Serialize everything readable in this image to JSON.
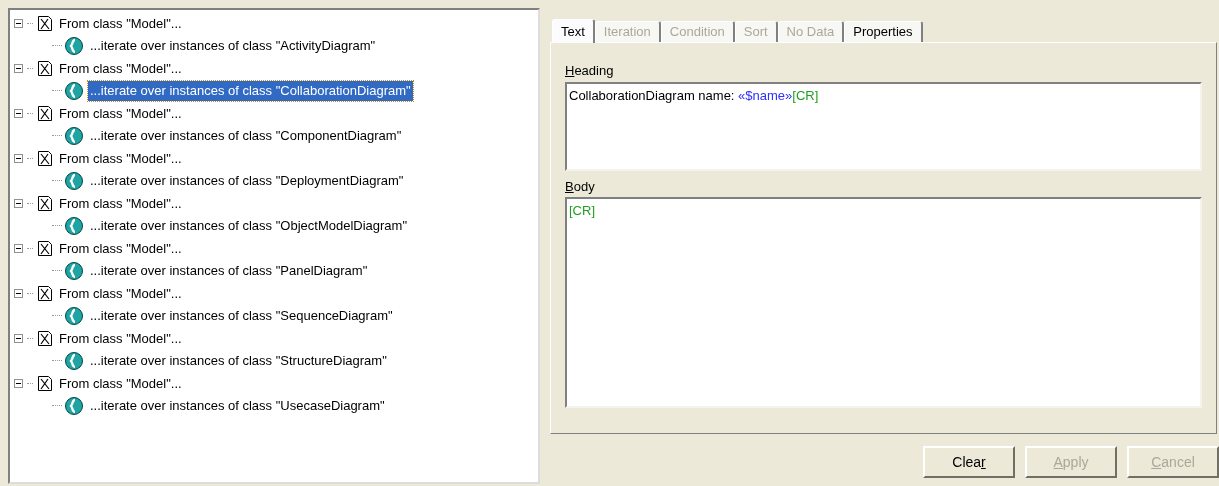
{
  "tree": [
    {
      "label": "From class \"Model\"...",
      "expanded": true,
      "children": [
        {
          "label": "...iterate over instances of class \"ActivityDiagram\"",
          "selected": false
        }
      ]
    },
    {
      "label": "From class \"Model\"...",
      "expanded": true,
      "children": [
        {
          "label": "...iterate over instances of class \"CollaborationDiagram\"",
          "selected": true
        }
      ]
    },
    {
      "label": "From class \"Model\"...",
      "expanded": true,
      "children": [
        {
          "label": "...iterate over instances of class \"ComponentDiagram\"",
          "selected": false
        }
      ]
    },
    {
      "label": "From class \"Model\"...",
      "expanded": true,
      "children": [
        {
          "label": "...iterate over instances of class \"DeploymentDiagram\"",
          "selected": false
        }
      ]
    },
    {
      "label": "From class \"Model\"...",
      "expanded": true,
      "children": [
        {
          "label": "...iterate over instances of class \"ObjectModelDiagram\"",
          "selected": false
        }
      ]
    },
    {
      "label": "From class \"Model\"...",
      "expanded": true,
      "children": [
        {
          "label": "...iterate over instances of class \"PanelDiagram\"",
          "selected": false
        }
      ]
    },
    {
      "label": "From class \"Model\"...",
      "expanded": true,
      "children": [
        {
          "label": "...iterate over instances of class \"SequenceDiagram\"",
          "selected": false
        }
      ]
    },
    {
      "label": "From class \"Model\"...",
      "expanded": true,
      "children": [
        {
          "label": "...iterate over instances of class \"StructureDiagram\"",
          "selected": false
        }
      ]
    },
    {
      "label": "From class \"Model\"...",
      "expanded": true,
      "children": [
        {
          "label": "...iterate over instances of class \"UsecaseDiagram\"",
          "selected": false
        }
      ]
    }
  ],
  "tabs": [
    {
      "label": "Text",
      "selected": true,
      "disabled": false
    },
    {
      "label": "Iteration",
      "selected": false,
      "disabled": true
    },
    {
      "label": "Condition",
      "selected": false,
      "disabled": true
    },
    {
      "label": "Sort",
      "selected": false,
      "disabled": true
    },
    {
      "label": "No Data",
      "selected": false,
      "disabled": true
    },
    {
      "label": "Properties",
      "selected": false,
      "disabled": false
    }
  ],
  "heading": {
    "label": [
      {
        "text": "H",
        "underlined": true
      },
      {
        "text": "eading",
        "underlined": false
      }
    ],
    "segments": [
      {
        "kind": "plain",
        "text": "CollaborationDiagram name: "
      },
      {
        "kind": "macro",
        "text": "«$name»"
      },
      {
        "kind": "tag",
        "text": "[CR]"
      }
    ]
  },
  "body": {
    "label": [
      {
        "text": "B",
        "underlined": true
      },
      {
        "text": "ody",
        "underlined": false
      }
    ],
    "segments": [
      {
        "kind": "tag",
        "text": "[CR]"
      }
    ]
  },
  "buttons": [
    {
      "label": [
        {
          "text": "Clea",
          "underlined": false
        },
        {
          "text": "r",
          "underlined": true
        }
      ],
      "disabled": false
    },
    {
      "label": [
        {
          "text": "A",
          "underlined": true
        },
        {
          "text": "pply",
          "underlined": false
        }
      ],
      "disabled": true
    },
    {
      "label": [
        {
          "text": "C",
          "underlined": true
        },
        {
          "text": "ancel",
          "underlined": false
        }
      ],
      "disabled": true
    }
  ]
}
